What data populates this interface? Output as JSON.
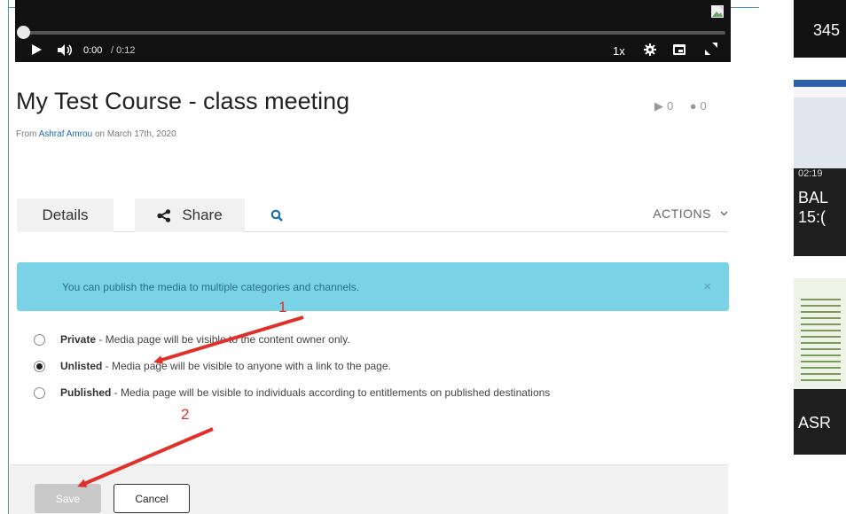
{
  "player": {
    "current_time": "0:00",
    "duration": "/ 0:12",
    "speed": "1x",
    "progress": 0
  },
  "media": {
    "title": "My Test Course - class meeting",
    "plays": "0",
    "comments": "0",
    "byline_prefix": "From",
    "author": "Ashraf Amrou",
    "byline_suffix": "on March 17th, 2020"
  },
  "tabs": {
    "details": "Details",
    "share": "Share",
    "actions": "ACTIONS"
  },
  "alert": {
    "text": "You can publish the media to multiple categories and channels.",
    "close": "×"
  },
  "options": [
    {
      "name": "Private",
      "desc": " - Media page will be visible to the content owner only.",
      "checked": false
    },
    {
      "name": "Unlisted",
      "desc": " - Media page will be visible to anyone with a link to the page.",
      "checked": true
    },
    {
      "name": "Published",
      "desc": " - Media page will be visible to individuals according to entitlements on published destinations",
      "checked": false
    }
  ],
  "footer": {
    "save": "Save",
    "cancel": "Cancel"
  },
  "sidebar": {
    "thumb1_text": "345",
    "thumb2_duration": "02:19",
    "thumb2_line1": "BAL",
    "thumb2_line2": "15:(",
    "thumb3_text": "ASR"
  },
  "annotations": {
    "label_1": "1",
    "label_2": "2",
    "color": "#e0302a"
  }
}
